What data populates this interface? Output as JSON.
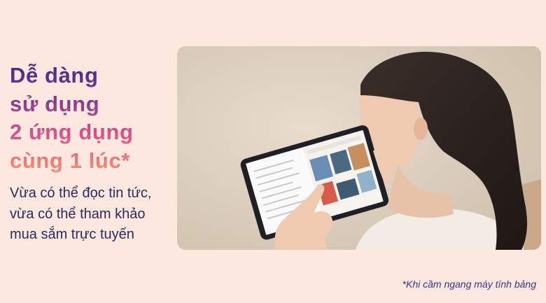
{
  "headline": {
    "line1": "Dễ dàng",
    "line2": "sử dụng",
    "line3": "2 ứng dụng",
    "line4": "cùng 1 lúc*"
  },
  "description": {
    "line1": "Vừa có thể đọc tin tức,",
    "line2": "vừa có thể tham khảo",
    "line3": "mua sắm trực tuyến"
  },
  "footnote": "*Khi cầm ngang máy tính bảng",
  "colors": {
    "background": "#fde8df",
    "headline_gradient": [
      "#3a2a86",
      "#e0508a",
      "#f7916a"
    ],
    "body_text": "#2b2a5c",
    "footnote_text": "#3f2f8a"
  }
}
